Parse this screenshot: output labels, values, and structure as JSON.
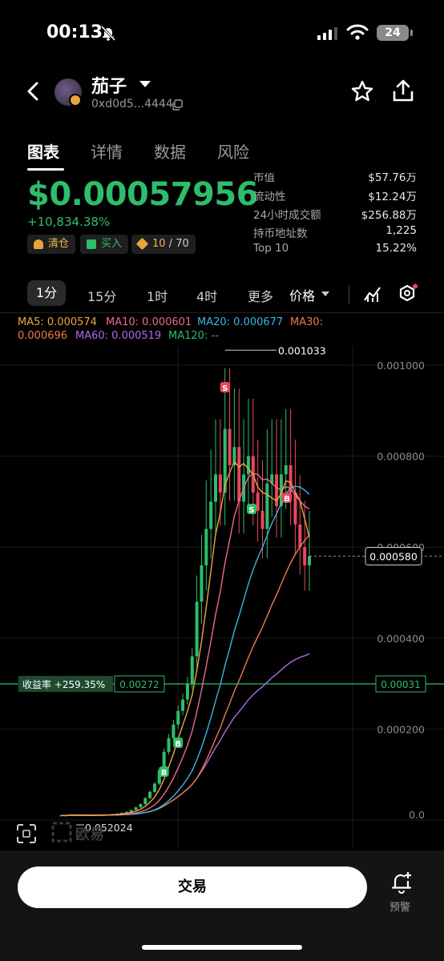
{
  "status_bar": {
    "time": "00:13",
    "battery": "24"
  },
  "header": {
    "token_name": "茄子",
    "address": "0xd0d5...4444"
  },
  "tabs": [
    "图表",
    "详情",
    "数据",
    "风险"
  ],
  "price": {
    "value": "$0.00057956",
    "change": "+10,834.38%"
  },
  "badges": {
    "clear": "清仓",
    "buy": "买入",
    "top_prefix": "10",
    "top_suffix": " / 70"
  },
  "stats": [
    {
      "label": "市值",
      "value": "$57.76万"
    },
    {
      "label": "流动性",
      "value": "$12.24万"
    },
    {
      "label": "24小时成交额",
      "value": "$256.88万"
    },
    {
      "label": "持币地址数",
      "value": "1,225"
    },
    {
      "label": "Top 10",
      "value": "15.22%"
    }
  ],
  "intervals": {
    "active": "1分",
    "items": [
      "15分",
      "1时",
      "4时",
      "更多"
    ],
    "price_select": "价格"
  },
  "ma_legend": {
    "ma5": "MA5: 0.000574",
    "ma10": "MA10: 0.000601",
    "ma20": "MA20: 0.000677",
    "ma30_a": "MA30:",
    "ma30_b": "0.000696",
    "ma60": "MA60: 0.000519",
    "ma120": "MA120: --"
  },
  "chart_data": {
    "type": "candlestick",
    "y_ticks": [
      "0.001000",
      "0.000800",
      "0.000600",
      "0.000400",
      "0.000200",
      "0.0"
    ],
    "high_label": "0.001033",
    "low_label": "0.052024",
    "current_price_label": "0.000580",
    "pnl_label": "收益率 +259.35%",
    "cost_price_label": "0.00272",
    "right_line_label": "0.00031",
    "watermark": "欧易",
    "trade_markers": [
      "S",
      "B",
      "S",
      "B",
      "B"
    ],
    "colors": {
      "up": "#2ebd6b",
      "down": "#e8475f",
      "ma5": "#f0a640",
      "ma10": "#f06a8a",
      "ma20": "#3ab6e6",
      "ma30": "#f07a50",
      "ma60": "#b06ae8"
    },
    "close_series": [
      1e-05,
      1e-05,
      1.2e-05,
      1.1e-05,
      1e-05,
      1.1e-05,
      1e-05,
      1.1e-05,
      1.2e-05,
      1.1e-05,
      1.2e-05,
      1.3e-05,
      1.4e-05,
      1.6e-05,
      1.8e-05,
      2.2e-05,
      2.8e-05,
      3.5e-05,
      4.8e-05,
      6.2e-05,
      8e-05,
      0.00011,
      0.00015,
      0.00018,
      0.00021,
      0.00024,
      0.000265,
      0.0003,
      0.00036,
      0.00048,
      0.00056,
      0.00064,
      0.0007,
      0.00076,
      0.00072,
      0.00086,
      0.00078,
      0.00082,
      0.0007,
      0.00076,
      0.0008,
      0.00072,
      0.00068,
      0.00064,
      0.00074,
      0.00076,
      0.00069,
      0.00076,
      0.00078,
      0.00072,
      0.00065,
      0.0006,
      0.00056,
      0.00058
    ]
  },
  "footer": {
    "trade_button": "交易",
    "alert_label": "预警"
  }
}
